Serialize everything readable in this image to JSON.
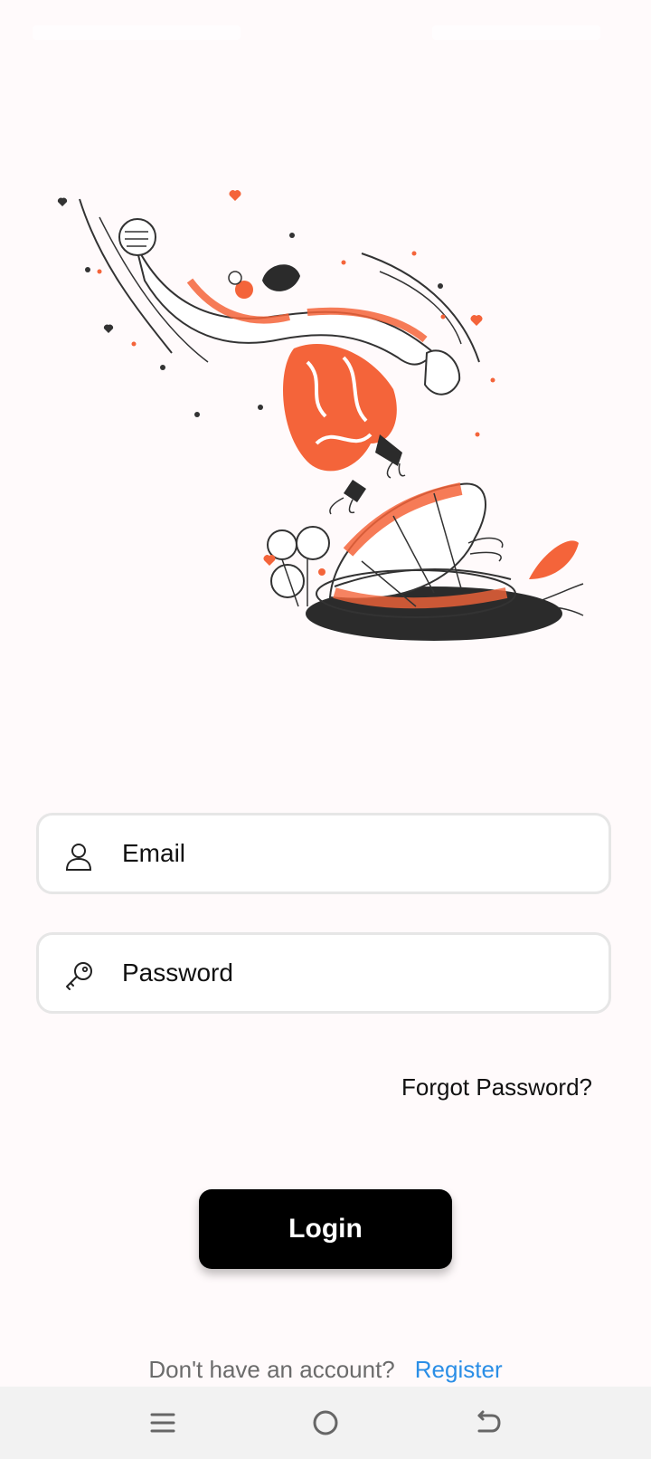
{
  "form": {
    "email_placeholder": "Email",
    "password_placeholder": "Password",
    "forgot_password": "Forgot Password?",
    "login_label": "Login"
  },
  "footer": {
    "question": "Don't have an account?",
    "register_label": "Register"
  },
  "icons": {
    "email": "person-icon",
    "password": "key-icon",
    "nav_menu": "menu-icon",
    "nav_home": "home-circle-icon",
    "nav_back": "back-icon"
  },
  "colors": {
    "accent": "#f4643a",
    "link": "#2a8ee6",
    "button": "#000000",
    "background": "#fffafb"
  }
}
